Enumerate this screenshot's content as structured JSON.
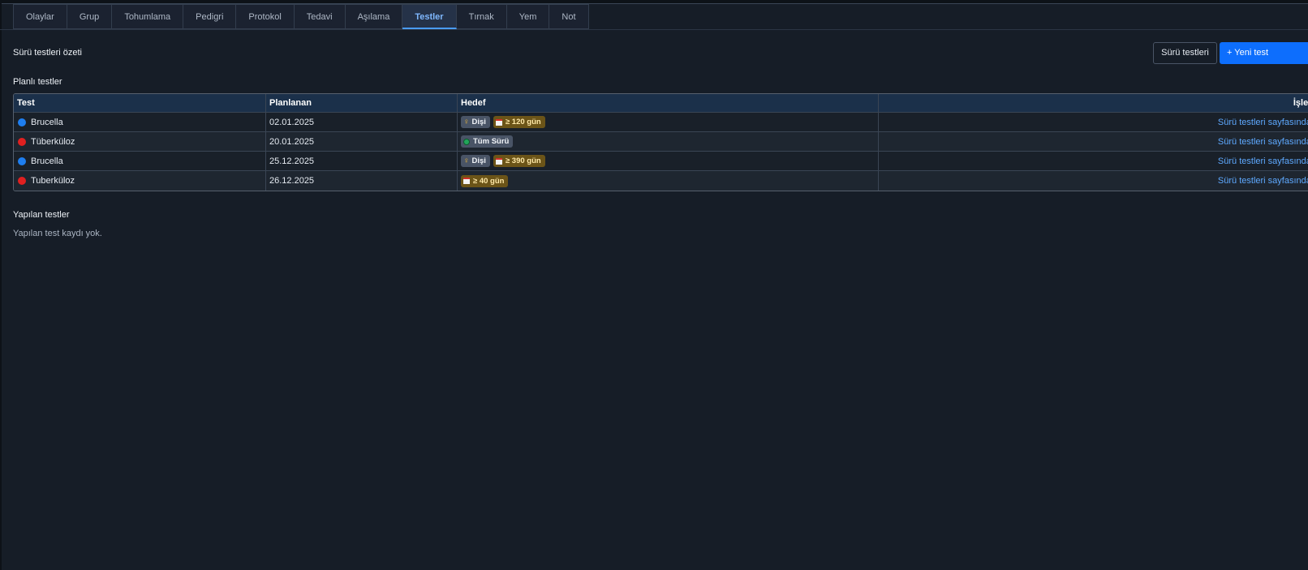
{
  "tabs": [
    {
      "label": "Olaylar"
    },
    {
      "label": "Grup"
    },
    {
      "label": "Tohumlama"
    },
    {
      "label": "Pedigri"
    },
    {
      "label": "Protokol"
    },
    {
      "label": "Tedavi"
    },
    {
      "label": "Aşılama"
    },
    {
      "label": "Testler"
    },
    {
      "label": "Tırnak"
    },
    {
      "label": "Yem"
    },
    {
      "label": "Not"
    }
  ],
  "active_tab": "Testler",
  "summary": {
    "title": "Sürü testleri özeti",
    "herd_tests_button": "Sürü testleri",
    "new_test_button": "+ Yeni test"
  },
  "planned": {
    "title": "Planlı testler",
    "columns": {
      "test": "Test",
      "planned": "Planlanan",
      "target": "Hedef",
      "action": "İşlem"
    },
    "rows": [
      {
        "test": "Brucella",
        "test_color": "#1e7ef0",
        "planned": "02.01.2025",
        "sex": "Dişi",
        "age": "≥ 120 gün",
        "action": "Sürü testleri sayfasından"
      },
      {
        "test": "Tüberküloz",
        "test_color": "#e02020",
        "planned": "20.01.2025",
        "herd": "Tüm Sürü",
        "action": "Sürü testleri sayfasından"
      },
      {
        "test": "Brucella",
        "test_color": "#1e7ef0",
        "planned": "25.12.2025",
        "sex": "Dişi",
        "age": "≥ 390 gün",
        "action": "Sürü testleri sayfasından"
      },
      {
        "test": "Tuberküloz",
        "test_color": "#e02020",
        "planned": "26.12.2025",
        "age": "≥ 40 gün",
        "action": "Sürü testleri sayfasından"
      }
    ]
  },
  "done": {
    "title": "Yapılan testler",
    "empty_text": "Yapılan test kaydı yok."
  },
  "colors": {
    "background": "#161d27",
    "accent": "#0d6efd",
    "link": "#5ea9ff",
    "badge_gray": "#495466",
    "badge_gold": "#6b5418"
  },
  "icons": {
    "sex": "female-icon",
    "age": "calendar-icon",
    "herd": "globe-icon"
  }
}
